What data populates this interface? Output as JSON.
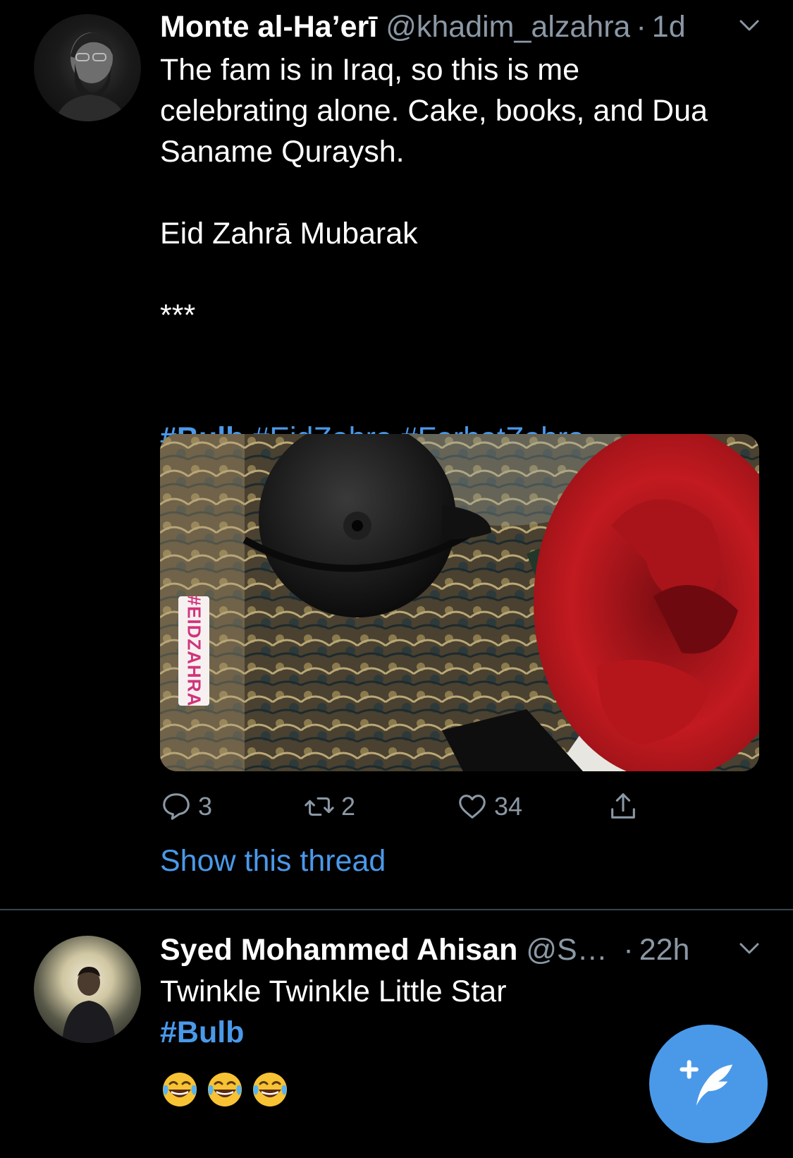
{
  "tweets": [
    {
      "display_name": "Monte al-Ha’erī",
      "handle": "@khadim_alzahra",
      "separator": "·",
      "time": "1d",
      "text_lines": [
        "The fam is in Iraq, so this is me",
        "celebrating alone. Cake, books, and Dua",
        "Saname Quraysh."
      ],
      "text_extra": [
        "Eid Zahrā Mubarak",
        "***"
      ],
      "hashtags": [
        "#Bulb",
        "#EidZahra",
        "#FarhatZahra"
      ],
      "media_sticker": "#EIDZAHRA",
      "counts": {
        "reply": "3",
        "retweet": "2",
        "like": "34"
      },
      "thread_link": "Show this thread"
    },
    {
      "display_name": "Syed Mohammed Ahisan",
      "handle": "@Sy…",
      "separator": "·",
      "time": "22h",
      "text": "Twinkle Twinkle Little Star",
      "hashtag": "#Bulb",
      "emojis": [
        "face-with-tears-of-joy",
        "face-with-tears-of-joy",
        "face-with-tears-of-joy"
      ]
    }
  ],
  "colors": {
    "background": "#000000",
    "accent": "#4a99e9",
    "secondary_text": "#8b98a5",
    "divider": "#38444d"
  },
  "icons": {
    "caret": "chevron-down-icon",
    "reply": "reply-icon",
    "retweet": "retweet-icon",
    "like": "heart-icon",
    "share": "share-icon",
    "compose": "compose-tweet-icon"
  }
}
